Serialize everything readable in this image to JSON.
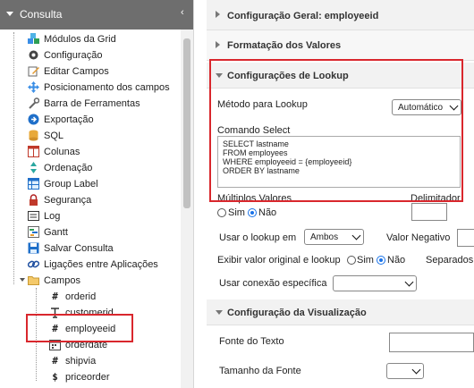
{
  "tree": {
    "title": "Consulta",
    "items": [
      {
        "label": "Módulos da Grid",
        "icon": "grid-modules-icon"
      },
      {
        "label": "Configuração",
        "icon": "gear-icon"
      },
      {
        "label": "Editar Campos",
        "icon": "edit-icon"
      },
      {
        "label": "Posicionamento dos campos",
        "icon": "move-icon"
      },
      {
        "label": "Barra de Ferramentas",
        "icon": "toolbar-icon"
      },
      {
        "label": "Exportação",
        "icon": "export-icon"
      },
      {
        "label": "SQL",
        "icon": "database-icon"
      },
      {
        "label": "Colunas",
        "icon": "columns-icon"
      },
      {
        "label": "Ordenação",
        "icon": "sort-icon"
      },
      {
        "label": "Group Label",
        "icon": "table-icon"
      },
      {
        "label": "Segurança",
        "icon": "lock-icon"
      },
      {
        "label": "Log",
        "icon": "log-icon"
      },
      {
        "label": "Gantt",
        "icon": "gantt-icon"
      },
      {
        "label": "Salvar Consulta",
        "icon": "save-icon"
      },
      {
        "label": "Ligações entre Aplicações",
        "icon": "link-icon"
      },
      {
        "label": "Campos",
        "icon": "folder-icon"
      }
    ],
    "fields": [
      {
        "label": "orderid",
        "icon": "hash-icon"
      },
      {
        "label": "customerid",
        "icon": "text-icon"
      },
      {
        "label": "employeeid",
        "icon": "hash-icon"
      },
      {
        "label": "orderdate",
        "icon": "calendar-icon"
      },
      {
        "label": "shipvia",
        "icon": "hash-icon"
      },
      {
        "label": "priceorder",
        "icon": "dollar-icon"
      }
    ]
  },
  "right": {
    "general_header": "Configuração Geral: employeeid",
    "format_header": "Formatação dos Valores",
    "lookup_header": "Configurações de Lookup",
    "lookup_method_label": "Método para Lookup",
    "lookup_method_value": "Automático",
    "command_label": "Comando Select",
    "sql_lines": [
      "SELECT lastname",
      "FROM employees",
      "WHERE employeeid = {employeeid}",
      "ORDER BY lastname"
    ],
    "multiple_label": "Múltiplos Valores",
    "delimiter_label": "Delimitador",
    "yes": "Sim",
    "no": "Não",
    "use_lookup_label": "Usar o lookup em",
    "use_lookup_value": "Ambos",
    "negative_label": "Valor Negativo",
    "show_original_label": "Exibir valor original e lookup",
    "separators_label": "Separados",
    "specific_conn_label": "Usar conexão específica",
    "view_header": "Configuração da Visualização",
    "font_label": "Fonte do Texto",
    "font_size_label": "Tamanho da Fonte"
  },
  "colors": {
    "highlight": "#d9272d",
    "radio_selected": "#1a73e8",
    "header_bg": "#6e6e6e"
  }
}
